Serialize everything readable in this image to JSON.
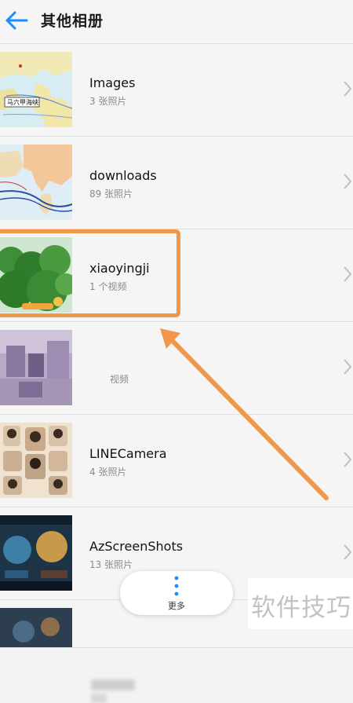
{
  "header": {
    "title": "其他相册",
    "back_icon": "arrow-left-icon"
  },
  "albums": [
    {
      "name": "Images",
      "count": "3 张照片",
      "thumb_label": "马六甲海峡"
    },
    {
      "name": "downloads",
      "count": "89 张照片"
    },
    {
      "name": "xiaoyingji",
      "count": "1 个视频"
    },
    {
      "name": "",
      "count": "视频"
    },
    {
      "name": "LINECamera",
      "count": "4 张照片"
    },
    {
      "name": "AzScreenShots",
      "count": "13 张照片"
    }
  ],
  "more": {
    "label": "更多",
    "icon": "more-vertical-icon"
  },
  "watermark": "软件技巧",
  "colors": {
    "accent": "#1a8cff",
    "highlight": "#f0974a"
  }
}
